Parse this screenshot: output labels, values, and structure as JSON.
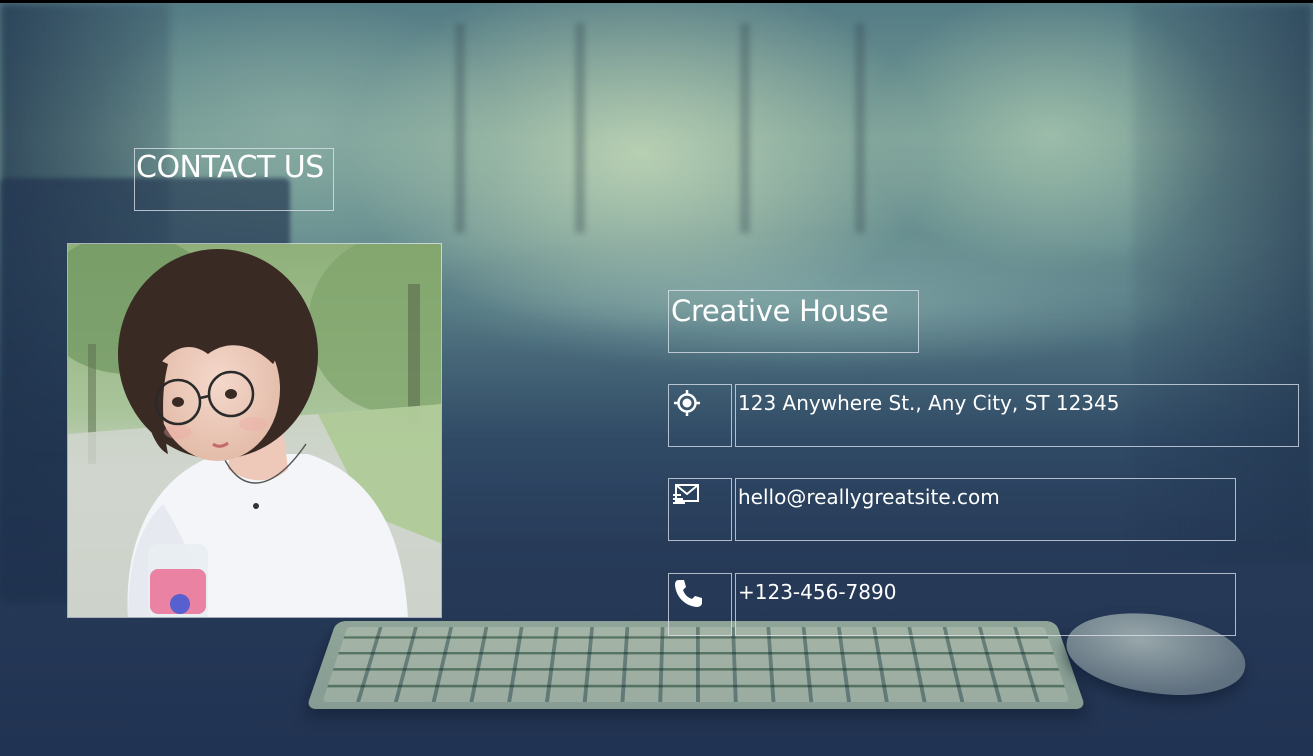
{
  "header": {
    "title": "CONTACT US"
  },
  "company": {
    "name": "Creative House"
  },
  "contacts": [
    {
      "icon": "location-target-icon",
      "value": "123 Anywhere St., Any City, ST 12345"
    },
    {
      "icon": "email-icon",
      "value": "hello@reallygreatsite.com"
    },
    {
      "icon": "phone-icon",
      "value": "+123-456-7890"
    }
  ],
  "colors": {
    "text": "#ffffff",
    "frame": "#e1e6f0",
    "background_dark": "#2c3f5d"
  }
}
